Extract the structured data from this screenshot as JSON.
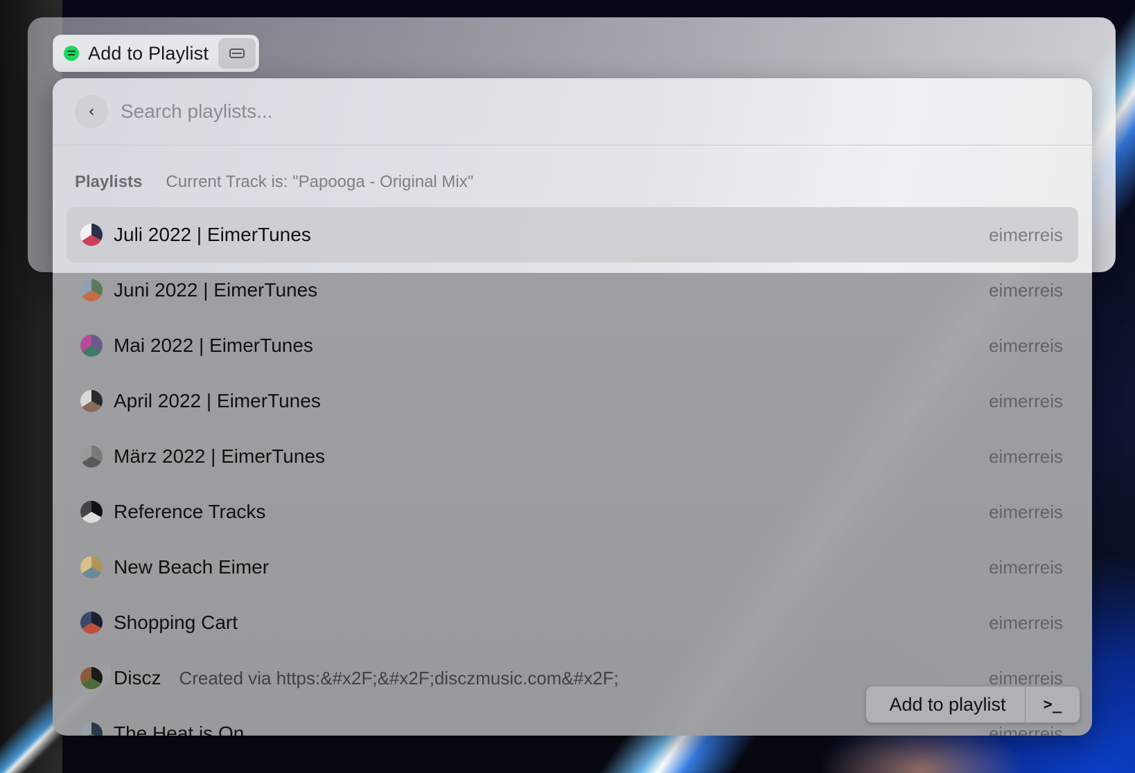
{
  "top_pill": {
    "title": "Add to Playlist",
    "app_icon": "spotify-icon",
    "action_icon": "tray-icon"
  },
  "search": {
    "placeholder": "Search playlists...",
    "value": "",
    "back_icon": "chevron-left-icon"
  },
  "section": {
    "title": "Playlists",
    "subtitle": "Current Track is: \"Papooga - Original Mix\""
  },
  "playlists": [
    {
      "title": "Juli 2022 | EimerTunes",
      "description": "",
      "owner": "eimerreis",
      "selected": true,
      "avatar_colors": [
        "#2b2f4a",
        "#c9405a",
        "#f2f2f2"
      ]
    },
    {
      "title": "Juni 2022 | EimerTunes",
      "description": "",
      "owner": "eimerreis",
      "selected": false,
      "avatar_colors": [
        "#5c7a5a",
        "#c46b4a",
        "#8fa0b0"
      ]
    },
    {
      "title": "Mai 2022 | EimerTunes",
      "description": "",
      "owner": "eimerreis",
      "selected": false,
      "avatar_colors": [
        "#6a5c8a",
        "#3f7a6a",
        "#b84a9a"
      ]
    },
    {
      "title": "April 2022 | EimerTunes",
      "description": "",
      "owner": "eimerreis",
      "selected": false,
      "avatar_colors": [
        "#2a2a2a",
        "#8a6a5a",
        "#d8d8d8"
      ]
    },
    {
      "title": "März 2022 | EimerTunes",
      "description": "",
      "owner": "eimerreis",
      "selected": false,
      "avatar_colors": [
        "#7a7a7a",
        "#5a5a5a",
        "#9a9a9a"
      ]
    },
    {
      "title": "Reference Tracks",
      "description": "",
      "owner": "eimerreis",
      "selected": false,
      "avatar_colors": [
        "#111111",
        "#dddddd",
        "#444444"
      ]
    },
    {
      "title": "New Beach Eimer",
      "description": "",
      "owner": "eimerreis",
      "selected": false,
      "avatar_colors": [
        "#b0945a",
        "#6a8a9a",
        "#d8c08a"
      ]
    },
    {
      "title": "Shopping Cart",
      "description": "",
      "owner": "eimerreis",
      "selected": false,
      "avatar_colors": [
        "#1a2030",
        "#c0503a",
        "#3a4a6a"
      ]
    },
    {
      "title": "Discz",
      "description": "Created via https:&#x2F;&#x2F;disczmusic.com&#x2F;",
      "owner": "eimerreis",
      "selected": false,
      "avatar_colors": [
        "#1a1a1a",
        "#4a6a3a",
        "#8a5a3a"
      ]
    },
    {
      "title": "The Heat is On",
      "description": "",
      "owner": "eimerreis",
      "selected": false,
      "avatar_colors": [
        "#2a3a4a",
        "#5a7a6a",
        "#9aa0a8"
      ]
    }
  ],
  "action_bar": {
    "label": "Add to playlist",
    "icon": "terminal-icon",
    "icon_glyph": ">_"
  }
}
